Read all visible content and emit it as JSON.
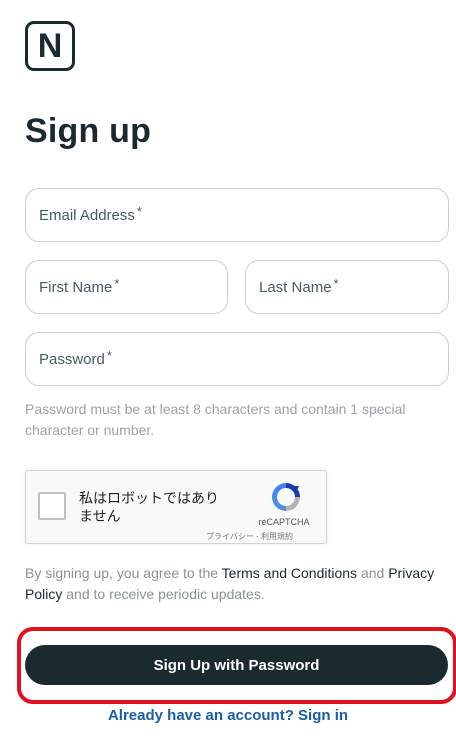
{
  "logo": {
    "letter": "N"
  },
  "title": "Sign up",
  "fields": {
    "email": {
      "label": "Email Address",
      "required": "*"
    },
    "first_name": {
      "label": "First Name",
      "required": "*"
    },
    "last_name": {
      "label": "Last Name",
      "required": "*"
    },
    "password": {
      "label": "Password",
      "required": "*"
    }
  },
  "password_hint": "Password must be at least 8 characters and contain 1 special character or number.",
  "captcha": {
    "label": "私はロボットではありません",
    "brand": "reCAPTCHA",
    "privacy": "プライバシー",
    "separator": "-",
    "terms": "利用規約"
  },
  "terms": {
    "prefix": "By signing up, you agree to the ",
    "terms_link": "Terms and Conditions",
    "middle": " and ",
    "privacy_link": "Privacy Policy",
    "suffix": " and to receive periodic updates."
  },
  "submit_label": "Sign Up with Password",
  "signin_link": "Already have an account? Sign in",
  "colors": {
    "primary": "#1b2a2f",
    "highlight": "#e0121f",
    "link": "#1a5ea8"
  }
}
